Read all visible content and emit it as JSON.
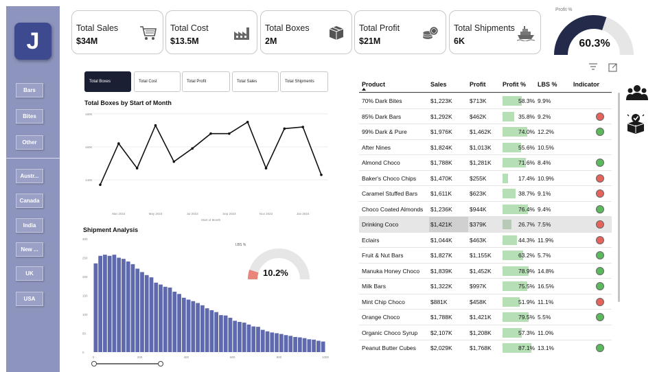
{
  "sidebar": {
    "logo_letter": "J",
    "product_buttons": [
      "Bars",
      "Bites",
      "Other"
    ],
    "country_buttons": [
      "Austr...",
      "Canada",
      "India",
      "New ...",
      "UK",
      "USA"
    ]
  },
  "kpis": [
    {
      "title": "Total Sales",
      "value": "$34M",
      "icon": "shopping-cart-icon"
    },
    {
      "title": "Total Cost",
      "value": "$13.5M",
      "icon": "factory-icon"
    },
    {
      "title": "Total Boxes",
      "value": "2M",
      "icon": "box-icon"
    },
    {
      "title": "Total Profit",
      "value": "$21M",
      "icon": "coins-icon"
    },
    {
      "title": "Total Shipments",
      "value": "6K",
      "icon": "ship-icon"
    }
  ],
  "profit_gauge": {
    "label": "Profit %",
    "value_text": "60.3%",
    "fraction": 0.603,
    "fill_color": "#242b4a",
    "track_color": "#e6e6e6"
  },
  "tabs": [
    "Total Boxes",
    "Total Cost",
    "Total Profit",
    "Total Sales",
    "Total Shipments"
  ],
  "active_tab": 0,
  "line_chart": {
    "title": "Total Boxes by Start of Month",
    "xlabel": "Start of Month",
    "y_ticks": [
      "140K",
      "160K",
      "180K"
    ],
    "x_ticks": [
      "Mar 2023",
      "May 2023",
      "Jul 2023",
      "Sep 2023",
      "Nov 2023",
      "Jan 2024"
    ]
  },
  "histogram": {
    "title": "Shipment Analysis",
    "y_ticks": [
      "0",
      "50",
      "100",
      "150",
      "200",
      "250",
      "300"
    ],
    "x_ticks": [
      "0",
      "200",
      "400",
      "600",
      "800",
      "1000"
    ],
    "slider_range": [
      0,
      300
    ]
  },
  "lbs_gauge": {
    "label": "LBS %",
    "value_text": "10.2%",
    "fraction": 0.102,
    "fill_color": "#e8867a",
    "track_color": "#e6e6e6"
  },
  "table": {
    "headers": [
      "Product",
      "Sales",
      "Profit",
      "Profit %",
      "LBS %",
      "Indicator"
    ],
    "rows": [
      {
        "product": "70% Dark Bites",
        "sales": "$1,223K",
        "profit": "$713K",
        "profit_pct": "58.3%",
        "pct": 58.3,
        "lbs": "9.9%",
        "indicator": ""
      },
      {
        "product": "85% Dark Bars",
        "sales": "$1,292K",
        "profit": "$462K",
        "profit_pct": "35.8%",
        "pct": 35.8,
        "lbs": "9.2%",
        "indicator": "red"
      },
      {
        "product": "99% Dark & Pure",
        "sales": "$1,976K",
        "profit": "$1,462K",
        "profit_pct": "74.0%",
        "pct": 74.0,
        "lbs": "12.2%",
        "indicator": "green"
      },
      {
        "product": "After Nines",
        "sales": "$1,824K",
        "profit": "$1,013K",
        "profit_pct": "55.6%",
        "pct": 55.6,
        "lbs": "10.5%",
        "indicator": ""
      },
      {
        "product": "Almond Choco",
        "sales": "$1,788K",
        "profit": "$1,281K",
        "profit_pct": "71.6%",
        "pct": 71.6,
        "lbs": "8.4%",
        "indicator": "green"
      },
      {
        "product": "Baker's Choco Chips",
        "sales": "$1,470K",
        "profit": "$255K",
        "profit_pct": "17.4%",
        "pct": 17.4,
        "lbs": "10.9%",
        "indicator": "red"
      },
      {
        "product": "Caramel Stuffed Bars",
        "sales": "$1,611K",
        "profit": "$623K",
        "profit_pct": "38.7%",
        "pct": 38.7,
        "lbs": "9.1%",
        "indicator": "red"
      },
      {
        "product": "Choco Coated Almonds",
        "sales": "$1,236K",
        "profit": "$944K",
        "profit_pct": "76.4%",
        "pct": 76.4,
        "lbs": "9.4%",
        "indicator": "green"
      },
      {
        "product": "Drinking Coco",
        "sales": "$1,421K",
        "profit": "$379K",
        "profit_pct": "26.7%",
        "pct": 26.7,
        "lbs": "7.5%",
        "indicator": "red"
      },
      {
        "product": "Eclairs",
        "sales": "$1,044K",
        "profit": "$463K",
        "profit_pct": "44.3%",
        "pct": 44.3,
        "lbs": "11.9%",
        "indicator": "red"
      },
      {
        "product": "Fruit & Nut Bars",
        "sales": "$1,827K",
        "profit": "$1,155K",
        "profit_pct": "63.2%",
        "pct": 63.2,
        "lbs": "5.7%",
        "indicator": "green"
      },
      {
        "product": "Manuka Honey Choco",
        "sales": "$1,839K",
        "profit": "$1,452K",
        "profit_pct": "78.9%",
        "pct": 78.9,
        "lbs": "14.8%",
        "indicator": "green"
      },
      {
        "product": "Milk Bars",
        "sales": "$1,322K",
        "profit": "$997K",
        "profit_pct": "75.5%",
        "pct": 75.5,
        "lbs": "16.5%",
        "indicator": "green"
      },
      {
        "product": "Mint Chip Choco",
        "sales": "$881K",
        "profit": "$458K",
        "profit_pct": "51.9%",
        "pct": 51.9,
        "lbs": "11.1%",
        "indicator": "red"
      },
      {
        "product": "Orange Choco",
        "sales": "$1,788K",
        "profit": "$1,421K",
        "profit_pct": "79.5%",
        "pct": 79.5,
        "lbs": "5.5%",
        "indicator": "green"
      },
      {
        "product": "Organic Choco Syrup",
        "sales": "$2,107K",
        "profit": "$1,208K",
        "profit_pct": "57.3%",
        "pct": 57.3,
        "lbs": "11.0%",
        "indicator": ""
      },
      {
        "product": "Peanut Butter Cubes",
        "sales": "$2,029K",
        "profit": "$1,768K",
        "profit_pct": "87.1%",
        "pct": 87.1,
        "lbs": "13.1%",
        "indicator": "green"
      }
    ],
    "highlighted_row": "Drinking Coco"
  },
  "colors": {
    "accent": "#1a1f33",
    "sidebar": "#8d94bd",
    "hist_bar": "#5f69ae",
    "green": "#5cb85c",
    "red": "#e4635a",
    "bar_fill": "#b7dfb5"
  },
  "side_icons": [
    "people-group-icon",
    "box-check-icon"
  ],
  "table_toolbar_icons": [
    "filter-icon",
    "focus-mode-icon"
  ],
  "chart_data": [
    {
      "type": "line",
      "title": "Total Boxes by Start of Month",
      "xlabel": "Start of Month",
      "ylabel": "",
      "x": [
        "Feb 2023",
        "Mar 2023",
        "Apr 2023",
        "May 2023",
        "Jun 2023",
        "Jul 2023",
        "Aug 2023",
        "Sep 2023",
        "Oct 2023",
        "Nov 2023",
        "Dec 2023",
        "Jan 2024",
        "Feb 2024"
      ],
      "values": [
        137,
        162,
        147,
        173,
        151,
        159,
        168,
        168,
        175,
        147,
        171,
        172,
        143
      ],
      "ylim": [
        130,
        182
      ],
      "grid": true
    },
    {
      "type": "bar",
      "title": "Shipment Analysis",
      "xlabel": "",
      "ylabel": "",
      "categories_start": 0,
      "bin_width": 20,
      "values": [
        235,
        255,
        258,
        255,
        258,
        250,
        247,
        240,
        233,
        221,
        212,
        204,
        198,
        184,
        179,
        173,
        171,
        160,
        154,
        144,
        139,
        135,
        130,
        124,
        116,
        111,
        106,
        98,
        97,
        91,
        83,
        80,
        78,
        73,
        68,
        67,
        59,
        55,
        52,
        50,
        48,
        45,
        43,
        40,
        39,
        37,
        34,
        33,
        30,
        28
      ],
      "ylim": [
        0,
        300
      ],
      "xlim": [
        0,
        1000
      ]
    }
  ]
}
